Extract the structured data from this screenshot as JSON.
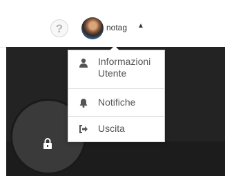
{
  "header": {
    "help_label": "?",
    "username": "notag",
    "caret": "▲"
  },
  "user_menu": {
    "items": [
      {
        "label_line1": "Informazioni",
        "label_line2": "Utente",
        "icon": "user-icon"
      },
      {
        "label": "Notifiche",
        "icon": "bell-icon"
      },
      {
        "label": "Uscita",
        "icon": "sign-out-icon"
      }
    ]
  },
  "lock": {
    "icon": "lock-icon"
  },
  "colors": {
    "menu_text": "#555555",
    "icon": "#555555",
    "dark_background": "#232323"
  }
}
